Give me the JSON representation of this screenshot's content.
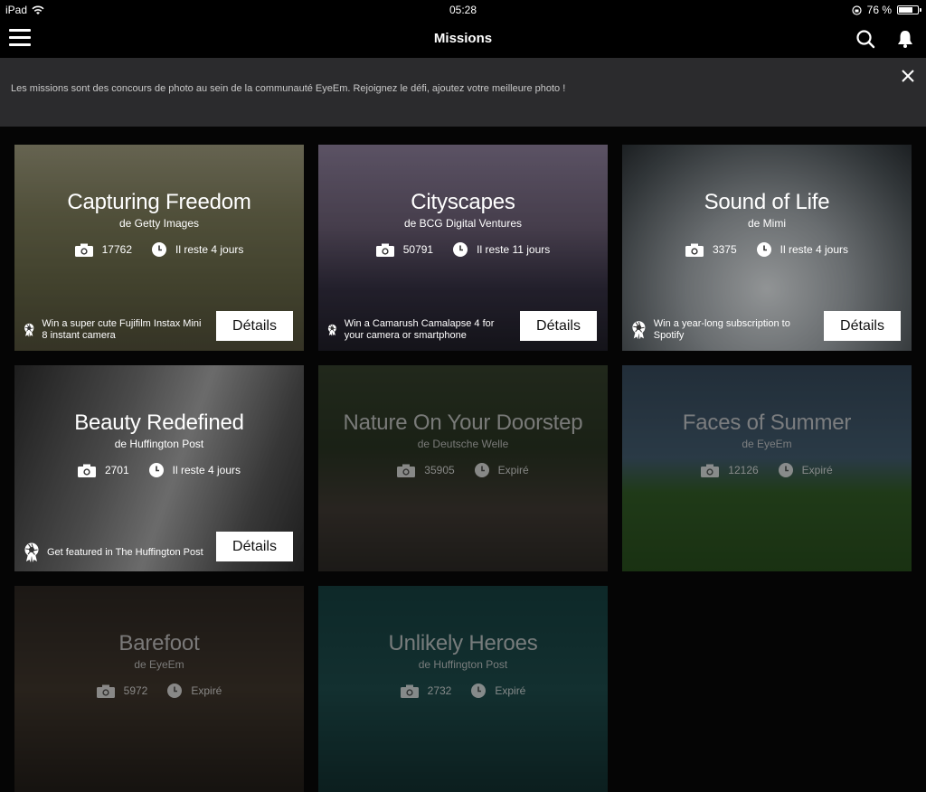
{
  "status": {
    "device": "iPad",
    "time": "05:28",
    "battery": "76 %",
    "battery_level": 0.76
  },
  "nav": {
    "title": "Missions"
  },
  "banner": {
    "text": "Les missions sont des concours de photo au sein de la communauté EyeEm. Rejoignez le défi, ajoutez votre meilleure photo !"
  },
  "cards": [
    {
      "title": "Capturing Freedom",
      "by": "de Getty Images",
      "photos": "17762",
      "time": "Il reste 4 jours",
      "reward": "Win a super cute Fujifilm Instax Mini 8 instant camera",
      "details": "Détails"
    },
    {
      "title": "Cityscapes",
      "by": "de BCG Digital Ventures",
      "photos": "50791",
      "time": "Il reste 11 jours",
      "reward": "Win a Camarush Camalapse 4 for your camera or smartphone",
      "details": "Détails"
    },
    {
      "title": "Sound of Life",
      "by": "de Mimi",
      "photos": "3375",
      "time": "Il reste 4 jours",
      "reward": "Win a year-long subscription to Spotify",
      "details": "Détails"
    },
    {
      "title": "Beauty Redefined",
      "by": "de Huffington Post",
      "photos": "2701",
      "time": "Il reste 4 jours",
      "reward": "Get featured in The Huffington Post",
      "details": "Détails"
    },
    {
      "title": "Nature On Your Doorstep",
      "by": "de Deutsche Welle",
      "photos": "35905",
      "time": "Expiré"
    },
    {
      "title": "Faces of Summer",
      "by": "de EyeEm",
      "photos": "12126",
      "time": "Expiré"
    },
    {
      "title": "Barefoot",
      "by": "de EyeEm",
      "photos": "5972",
      "time": "Expiré"
    },
    {
      "title": "Unlikely Heroes",
      "by": "de Huffington Post",
      "photos": "2732",
      "time": "Expiré"
    }
  ]
}
